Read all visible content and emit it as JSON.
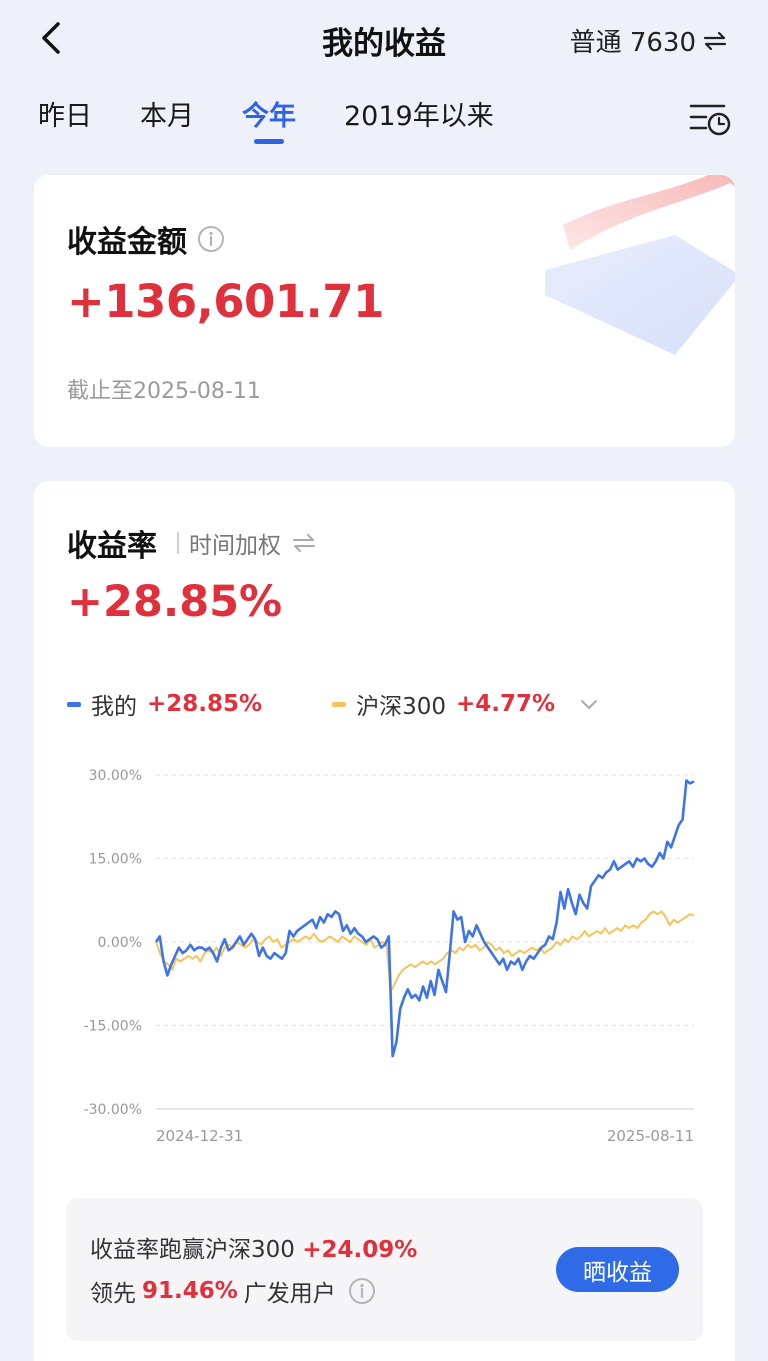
{
  "header": {
    "title": "我的收益",
    "account": "普通 7630"
  },
  "tabs": [
    {
      "label": "昨日",
      "active": false
    },
    {
      "label": "本月",
      "active": false
    },
    {
      "label": "今年",
      "active": true
    },
    {
      "label": "2019年以来",
      "active": false
    }
  ],
  "earnings": {
    "label": "收益金额",
    "amount": "+136,601.71",
    "as_of": "截止至2025-08-11"
  },
  "rate": {
    "label": "收益率",
    "mode": "时间加权",
    "value": "+28.85%"
  },
  "legend": [
    {
      "name": "我的",
      "value": "+28.85%",
      "color": "#3f74e6"
    },
    {
      "name": "沪深300",
      "value": "+4.77%",
      "color": "#f5c45a"
    }
  ],
  "chart_data": {
    "type": "line",
    "x_start_label": "2024-12-31",
    "x_end_label": "2025-08-11",
    "y_ticks": [
      "30.00%",
      "15.00%",
      "0.00%",
      "-15.00%",
      "-30.00%"
    ],
    "ylim": [
      -30,
      30
    ],
    "series": [
      {
        "name": "我的",
        "color": "#3f74e6",
        "values": [
          0.0,
          1.0,
          -3.5,
          -6.0,
          -4.0,
          -2.5,
          -1.0,
          -2.0,
          -1.5,
          -0.5,
          -1.5,
          -1.0,
          -1.0,
          -1.5,
          -1.0,
          -2.0,
          -3.5,
          -1.0,
          0.5,
          -1.5,
          -1.0,
          0.0,
          1.0,
          -0.5,
          0.5,
          1.5,
          0.5,
          -2.5,
          -1.0,
          -2.5,
          -3.0,
          -2.0,
          -2.5,
          -3.0,
          -2.0,
          2.0,
          1.0,
          2.0,
          2.5,
          3.0,
          3.5,
          4.0,
          2.5,
          4.5,
          3.5,
          5.0,
          4.5,
          5.5,
          5.0,
          2.0,
          3.0,
          1.5,
          2.5,
          1.5,
          1.0,
          0.0,
          0.5,
          1.0,
          0.5,
          -1.0,
          -0.5,
          1.0,
          -20.5,
          -18.0,
          -12.0,
          -10.0,
          -8.5,
          -10.0,
          -9.5,
          -10.5,
          -8.0,
          -10.0,
          -7.0,
          -9.5,
          -5.0,
          -7.0,
          -9.0,
          -2.0,
          5.5,
          4.0,
          4.5,
          0.0,
          2.0,
          1.0,
          3.0,
          1.5,
          0.0,
          -1.0,
          -2.0,
          -3.0,
          -4.0,
          -3.0,
          -5.0,
          -3.5,
          -4.0,
          -3.0,
          -5.0,
          -3.5,
          -2.5,
          -3.0,
          -2.0,
          -1.0,
          -0.5,
          1.0,
          0.5,
          3.5,
          9.0,
          6.0,
          9.5,
          7.0,
          5.0,
          8.5,
          7.0,
          6.0,
          10.0,
          11.0,
          12.0,
          11.5,
          12.5,
          13.0,
          14.5,
          13.0,
          13.5,
          14.0,
          14.5,
          13.5,
          15.0,
          14.5,
          15.0,
          14.0,
          13.5,
          14.5,
          16.0,
          15.0,
          18.0,
          17.0,
          19.0,
          21.0,
          22.0,
          29.0,
          28.5,
          28.85
        ]
      },
      {
        "name": "沪深300",
        "color": "#f5c45a",
        "values": [
          0.0,
          -2.0,
          -3.5,
          -4.0,
          -5.0,
          -3.0,
          -3.5,
          -3.0,
          -2.5,
          -3.0,
          -2.5,
          -3.5,
          -2.0,
          -1.5,
          -2.0,
          -1.0,
          -2.5,
          -1.0,
          -0.5,
          -1.0,
          0.0,
          -0.5,
          -1.0,
          -0.5,
          0.5,
          0.0,
          -0.5,
          0.5,
          1.0,
          0.0,
          0.5,
          -1.0,
          -0.5,
          0.0,
          0.5,
          0.0,
          0.5,
          1.0,
          0.5,
          1.5,
          0.5,
          0.0,
          0.5,
          1.0,
          0.5,
          0.0,
          1.0,
          0.5,
          0.0,
          1.0,
          0.5,
          0.0,
          -0.5,
          0.5,
          -1.0,
          -0.5,
          0.0,
          -0.5,
          -9.0,
          -7.5,
          -6.0,
          -5.0,
          -4.5,
          -4.0,
          -4.5,
          -4.0,
          -3.5,
          -4.0,
          -3.5,
          -4.0,
          -3.5,
          -3.0,
          -2.0,
          -1.5,
          -2.0,
          -1.0,
          -1.5,
          -0.5,
          -1.0,
          -0.5,
          -1.5,
          -1.0,
          0.0,
          -0.5,
          -1.5,
          -1.0,
          -2.0,
          -1.5,
          -2.5,
          -2.0,
          -1.5,
          -2.0,
          -1.5,
          -1.0,
          -1.5,
          -1.0,
          -2.0,
          -1.5,
          -1.0,
          0.0,
          -0.5,
          0.5,
          0.0,
          1.0,
          0.5,
          1.0,
          2.0,
          1.0,
          1.5,
          2.0,
          1.5,
          2.5,
          1.5,
          2.0,
          2.5,
          2.0,
          3.0,
          2.5,
          3.0,
          2.5,
          3.5,
          4.0,
          5.0,
          5.5,
          5.0,
          5.5,
          4.5,
          3.0,
          4.0,
          3.5,
          4.0,
          4.5,
          5.0,
          4.77
        ]
      }
    ]
  },
  "summary": {
    "line1_text": "收益率跑赢沪深300",
    "line1_value": "+24.09%",
    "line2_prefix": "领先",
    "line2_value": "91.46%",
    "line2_suffix": "广发用户",
    "share_button": "晒收益"
  },
  "colors": {
    "accent": "#2f63e0",
    "positive": "#e0303b",
    "background": "#eef1fa"
  }
}
